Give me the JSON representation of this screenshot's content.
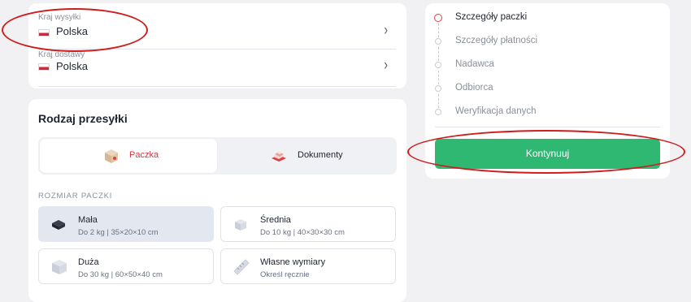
{
  "countries": {
    "sender_label": "Kraj wysyłki",
    "sender_value": "Polska",
    "delivery_label": "Kraj dostawy",
    "delivery_value": "Polska"
  },
  "shipment": {
    "title": "Rodzaj przesyłki",
    "types": [
      {
        "label": "Paczka",
        "icon": "parcel-box-icon",
        "active": true
      },
      {
        "label": "Dokumenty",
        "icon": "documents-icon",
        "active": false
      }
    ],
    "size_title": "ROZMIAR PACZKI",
    "sizes": [
      {
        "name": "Mała",
        "desc": "Do 2 kg | 35×20×10 cm",
        "icon": "small-box-icon",
        "selected": true
      },
      {
        "name": "Średnia",
        "desc": "Do 10 kg | 40×30×30 cm",
        "icon": "medium-box-icon",
        "selected": false
      },
      {
        "name": "Duża",
        "desc": "Do 30 kg | 60×50×40 cm",
        "icon": "large-box-icon",
        "selected": false
      },
      {
        "name": "Własne wymiary",
        "desc": "Określ ręcznie",
        "icon": "ruler-icon",
        "selected": false
      }
    ]
  },
  "steps": {
    "items": [
      {
        "label": "Szczegóły paczki",
        "active": true
      },
      {
        "label": "Szczegóły płatności",
        "active": false
      },
      {
        "label": "Nadawca",
        "active": false
      },
      {
        "label": "Odbiorca",
        "active": false
      },
      {
        "label": "Weryfikacja danych",
        "active": false
      }
    ],
    "continue_label": "Kontynuuj"
  },
  "colors": {
    "accent_red": "#e0404a",
    "button_green": "#2eb872",
    "annotation_red": "#cf1d1d"
  }
}
